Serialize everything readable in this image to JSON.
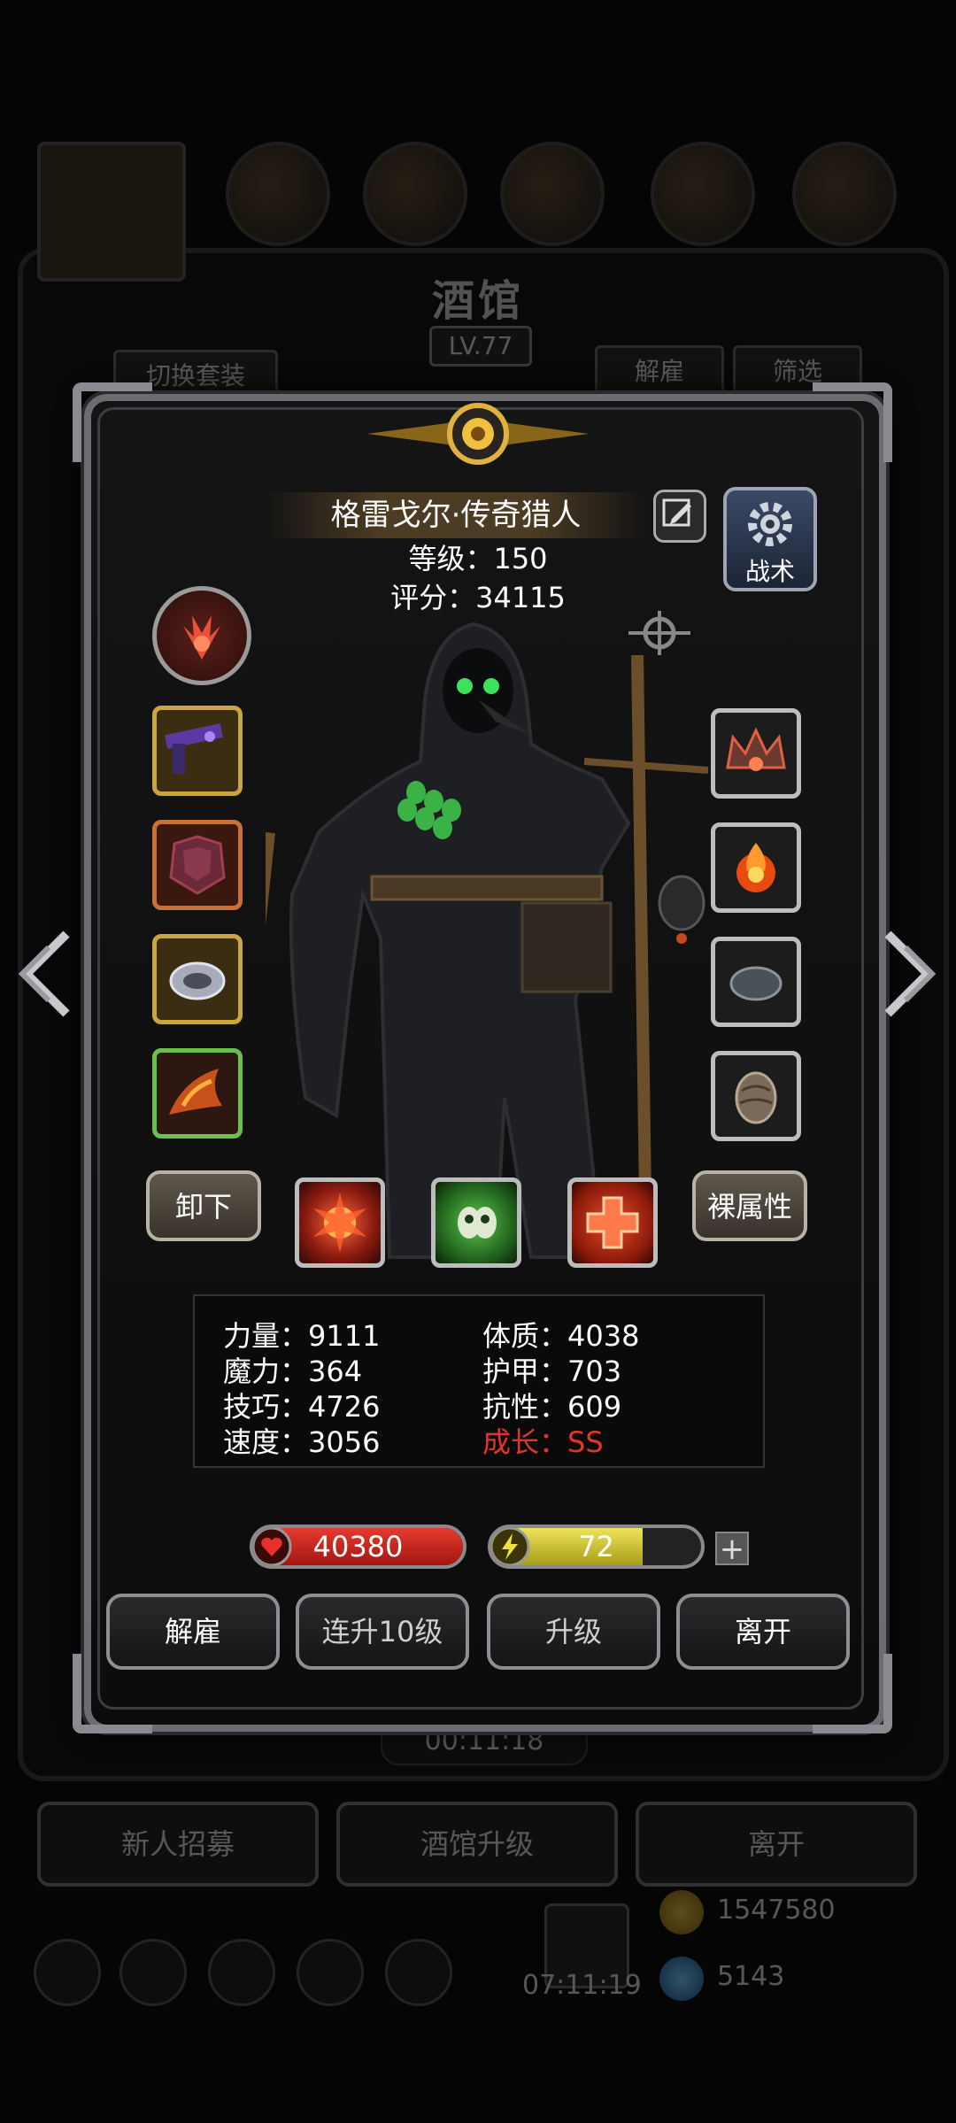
{
  "background": {
    "title": "酒馆",
    "level": "LV.77",
    "switch_set_label": "切换套装",
    "dismiss_label": "解雇",
    "filter_label": "筛选",
    "timer": "00:11:18",
    "recruit_label": "新人招募",
    "upgrade_tavern_label": "酒馆升级",
    "leave_label": "离开",
    "bottom_timer": "07:11:19",
    "gold": "1547580",
    "gems": "5143"
  },
  "hero": {
    "name": "格雷戈尔·传奇猎人",
    "level_text": "等级：150",
    "score_text": "评分：34115",
    "tactic_label": "战术"
  },
  "buttons": {
    "unequip": "卸下",
    "base_attributes": "裸属性"
  },
  "stats": {
    "strength": "力量：9111",
    "magic": "魔力：364",
    "skill": "技巧：4726",
    "speed": "速度：3056",
    "constitution": "体质：4038",
    "armor": "护甲：703",
    "resistance": "抗性：609",
    "growth": "成长：SS"
  },
  "bars": {
    "hp_value": "40380",
    "hp_fraction": 1.0,
    "energy_value": "72",
    "energy_fraction": 0.72,
    "plus": "+"
  },
  "actions": {
    "dismiss": "解雇",
    "level_up_10": "连升10级",
    "upgrade": "升级",
    "leave": "离开"
  },
  "colors": {
    "growth_red": "#e2352a",
    "hp_red": "#d4261c",
    "energy_yellow": "#d9cf3a"
  }
}
